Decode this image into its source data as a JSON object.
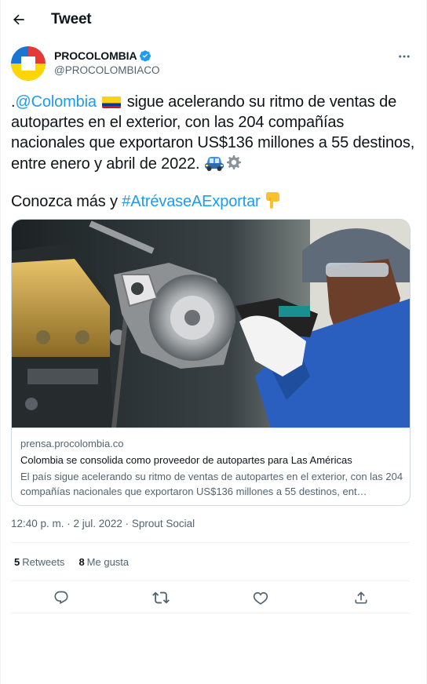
{
  "header": {
    "title": "Tweet",
    "back_icon": "arrow-left-icon"
  },
  "author": {
    "name": "PROCOLOMBIA",
    "handle": "@PROCOLOMBIACO",
    "verified": true,
    "more_icon": "more-horizontal-icon"
  },
  "tweet": {
    "prefix": ".",
    "mention": "@Colombia",
    "body": " sigue acelerando su ritmo de ventas de autopartes en el exterior, con las 204 compañías nacionales que exportaron US$136 millones a 55 destinos, entre enero y abril de 2022. ",
    "line2_prefix": "Conozca más y ",
    "hashtag": "#AtrévaseAExportar",
    "emojis": [
      "colombia-flag",
      "car-icon",
      "gear-icon",
      "pointing-down-hand-icon"
    ]
  },
  "card": {
    "domain": "prensa.procolombia.co",
    "title": "Colombia se consolida como proveedor de autopartes para Las Américas",
    "description": "El país sigue acelerando su ritmo de ventas de autopartes en el exterior, con las 204 compañías nacionales que exportaron US$136 millones a 55 destinos, ent…"
  },
  "meta": {
    "timestamp": "12:40 p. m. · 2 jul. 2022 · Sprout Social"
  },
  "stats": {
    "retweets_count": "5",
    "retweets_label": "Retweets",
    "likes_count": "8",
    "likes_label": "Me gusta"
  },
  "actions": [
    "reply-icon",
    "retweet-icon",
    "like-icon",
    "share-icon"
  ],
  "colors": {
    "link": "#1d9bf0",
    "text": "#0f1419",
    "muted": "#536471",
    "border": "#cfd9de"
  }
}
